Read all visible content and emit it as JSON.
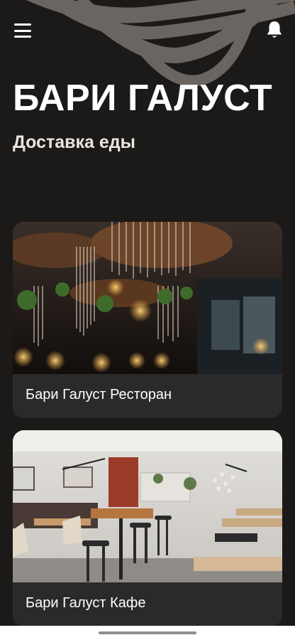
{
  "header": {
    "menu_icon": "menu-icon",
    "notifications_icon": "bell-icon",
    "title": "БАРИ ГАЛУСТ",
    "subtitle": "Доставка еды"
  },
  "cards": [
    {
      "label": "Бари Галуст Ресторан",
      "image": "restaurant-interior-photo"
    },
    {
      "label": "Бари Галуст Кафе",
      "image": "cafe-interior-photo"
    }
  ],
  "colors": {
    "background": "#1c1a19",
    "card_background": "#2b2a2a",
    "wave_pattern": "#6b6561",
    "text": "#ffffff"
  }
}
